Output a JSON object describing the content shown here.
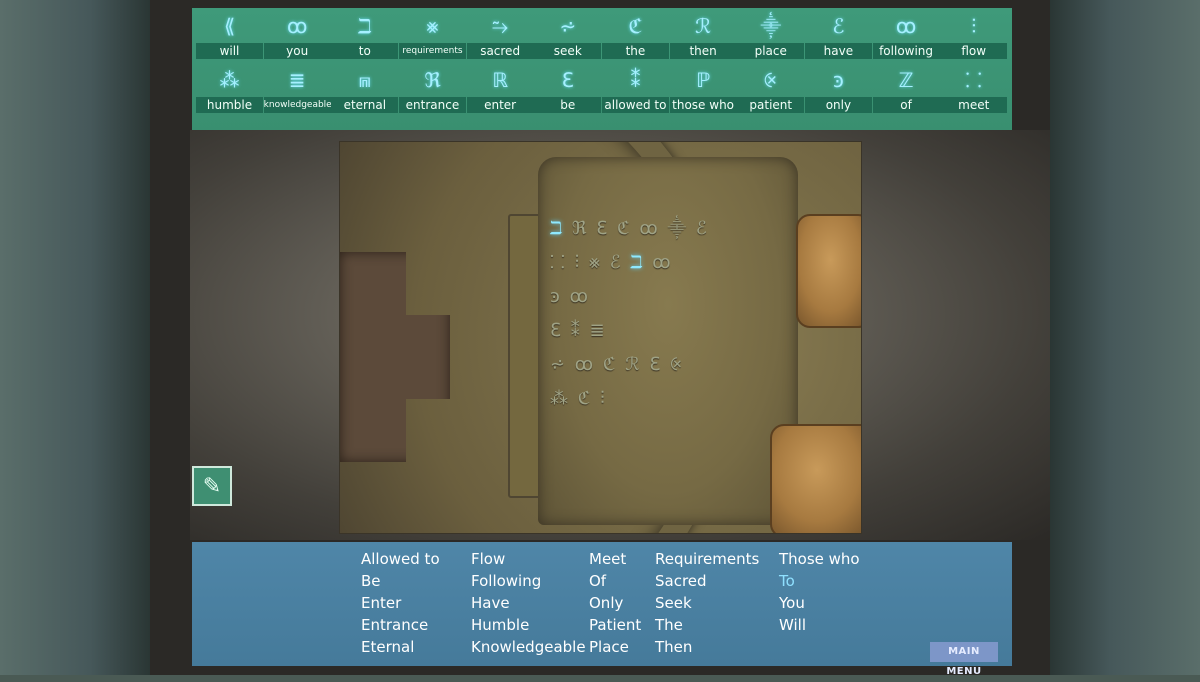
{
  "glossary": {
    "row1": [
      {
        "glyph": "⟪",
        "label": "will"
      },
      {
        "glyph": "ꝏ",
        "label": "you"
      },
      {
        "glyph": "ℶ",
        "label": "to"
      },
      {
        "glyph": "⨳",
        "label": "requirements"
      },
      {
        "glyph": "⥲",
        "label": "sacred"
      },
      {
        "glyph": "⩫",
        "label": "seek"
      },
      {
        "glyph": "ℭ",
        "label": "the"
      },
      {
        "glyph": "ℛ",
        "label": "then"
      },
      {
        "glyph": "⸎",
        "label": "place"
      },
      {
        "glyph": "ℰ",
        "label": "have"
      },
      {
        "glyph": "ꝏ",
        "label": "following"
      },
      {
        "glyph": "⫶",
        "label": "flow"
      }
    ],
    "row2": [
      {
        "glyph": "⁂",
        "label": "humble"
      },
      {
        "glyph": "≣",
        "label": "knowledgeable"
      },
      {
        "glyph": "⩎",
        "label": "eternal"
      },
      {
        "glyph": "ℜ",
        "label": "entrance"
      },
      {
        "glyph": "ℝ",
        "label": "enter"
      },
      {
        "glyph": "ℇ",
        "label": "be"
      },
      {
        "glyph": "⁑",
        "label": "allowed to"
      },
      {
        "glyph": "ℙ",
        "label": "those who"
      },
      {
        "glyph": "⨴",
        "label": "patient"
      },
      {
        "glyph": "ꜿ",
        "label": "only"
      },
      {
        "glyph": "ℤ",
        "label": "of"
      },
      {
        "glyph": "⸬",
        "label": "meet"
      }
    ]
  },
  "tablet": {
    "lines": [
      [
        {
          "t": "ℶ",
          "hl": true
        },
        {
          "t": " ℜ ℇ ℭ ꝏ ⸎ ℰ",
          "hl": false
        }
      ],
      [
        {
          "t": "⸬ ⫶ ⨳ ℰ ",
          "hl": false
        },
        {
          "t": "ℶ",
          "hl": true
        },
        {
          "t": " ꝏ",
          "hl": false
        }
      ],
      [
        {
          "t": "ꜿ ꝏ",
          "hl": false
        }
      ],
      [
        {
          "t": "ℇ ⁑ ≣",
          "hl": false
        }
      ],
      [
        {
          "t": "⩫ ꝏ ℭ ℛ ℇ ⨴",
          "hl": false
        }
      ],
      [
        {
          "t": "⁂ ℭ ⫶",
          "hl": false
        }
      ]
    ]
  },
  "quill_icon": "quill-icon",
  "word_bank": {
    "columns": [
      [
        "Allowed to",
        "Be",
        "Enter",
        "Entrance",
        "Eternal"
      ],
      [
        "Flow",
        "Following",
        "Have",
        "Humble",
        "Knowledgeable"
      ],
      [
        "Meet",
        "Of",
        "Only",
        "Patient",
        "Place"
      ],
      [
        "Requirements",
        "Sacred",
        "Seek",
        "The",
        "Then"
      ],
      [
        "Those who",
        "To",
        "You",
        "Will"
      ]
    ],
    "active_word": "To",
    "main_menu_label": "MAIN MENU"
  },
  "colors": {
    "glossary_bg": "#3f9a7a",
    "glyph": "#a6f0ff",
    "word_panel_bg": "#4f86a8",
    "active_word": "#8fe0ff",
    "main_menu_bg": "#7d96c8"
  }
}
